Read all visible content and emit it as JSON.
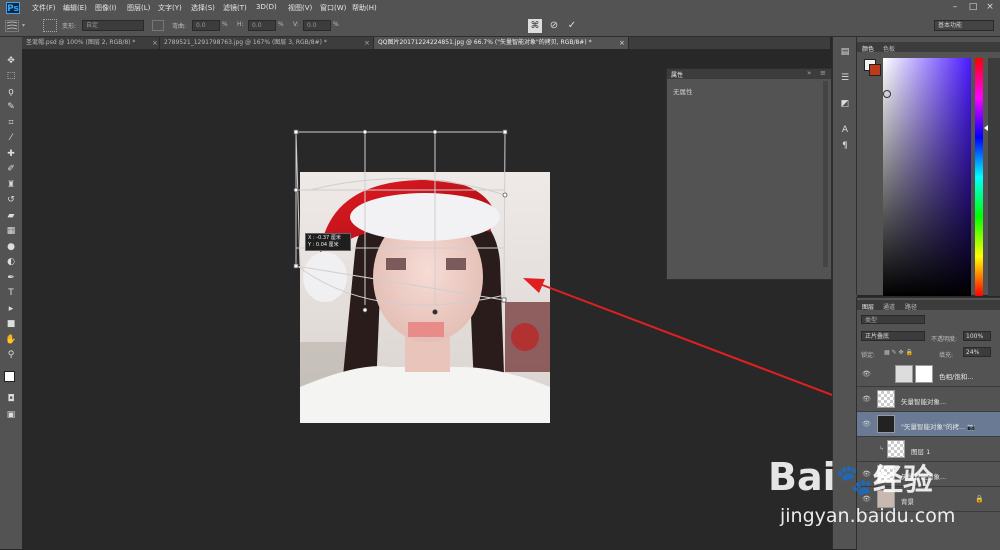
{
  "app": {
    "logo": "Ps"
  },
  "menu": [
    "文件(F)",
    "编辑(E)",
    "图像(I)",
    "图层(L)",
    "文字(Y)",
    "选择(S)",
    "滤镜(T)",
    "3D(D)",
    "视图(V)",
    "窗口(W)",
    "帮助(H)"
  ],
  "options": {
    "transform_label": "变形:",
    "transform_value": "自定",
    "bend_label": "弯曲:",
    "bend_value": "0.0",
    "pct1": "%",
    "h_label": "H:",
    "h_value": "0.0",
    "pct2": "%",
    "v_label": "V:",
    "v_value": "0.0",
    "pct3": "%",
    "workspace": "基本功能"
  },
  "tabs": [
    "圣诞帽.psd @ 100% (图层 2, RGB/8) *",
    "2789521_1291798763.jpg @ 167% (图层 3, RGB/8#) *",
    "QQ图片20171224224851.jpg @ 66.7% (\"矢量智能对象\"的拷贝, RGB/8#) *"
  ],
  "tooltip": {
    "x": "X : -0.37 厘米",
    "y": "Y :  0.04 厘米"
  },
  "properties": {
    "title": "属性",
    "empty": "无属性"
  },
  "color_panel": {
    "tab1": "颜色",
    "tab2": "色板"
  },
  "layers_panel": {
    "tab1": "图层",
    "tab2": "通道",
    "tab3": "路径",
    "kind": "类型",
    "blend": "正片叠底",
    "opacity_label": "不透明度:",
    "opacity": "100%",
    "lock_label": "锁定:",
    "fill_label": "填充:",
    "fill": "24%",
    "layers": [
      {
        "name": "色相/饱和...",
        "selected": false
      },
      {
        "name": "矢量智能对象...",
        "selected": false
      },
      {
        "name": "\"矢量智能对象\"的拷... 📷",
        "selected": true
      },
      {
        "name": "图层 1",
        "selected": false
      },
      {
        "name": "矢量智能对象...",
        "selected": false
      },
      {
        "name": "背景",
        "selected": false
      }
    ]
  },
  "watermark": {
    "brand": "Bai",
    "brand2": "经验",
    "url": "jingyan.baidu.com"
  },
  "accent": {
    "selected_layer": "#6a7a94",
    "arrow": "#e02020",
    "hat_red": "#c8101a"
  }
}
